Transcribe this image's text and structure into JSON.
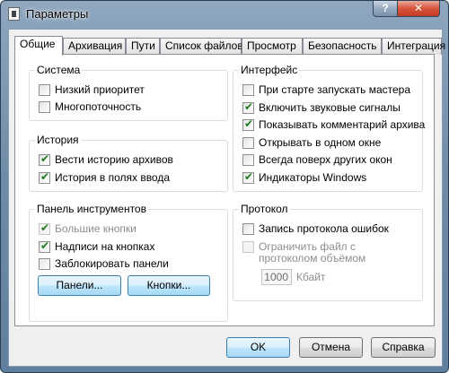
{
  "window": {
    "title": "Параметры",
    "help": "?",
    "close": "✕"
  },
  "tabs": [
    "Общие",
    "Архивация",
    "Пути",
    "Список файлов",
    "Просмотр",
    "Безопасность",
    "Интеграция"
  ],
  "groups": {
    "system": {
      "title": "Система",
      "items": [
        {
          "label": "Низкий приоритет",
          "checked": false,
          "disabled": false
        },
        {
          "label": "Многопоточность",
          "checked": false,
          "disabled": false
        }
      ]
    },
    "history": {
      "title": "История",
      "items": [
        {
          "label": "Вести историю архивов",
          "checked": true,
          "disabled": false
        },
        {
          "label": "История в полях ввода",
          "checked": true,
          "disabled": false
        }
      ]
    },
    "toolbar": {
      "title": "Панель инструментов",
      "items": [
        {
          "label": "Большие кнопки",
          "checked": true,
          "disabled": true
        },
        {
          "label": "Надписи на кнопках",
          "checked": true,
          "disabled": false
        },
        {
          "label": "Заблокировать панели",
          "checked": false,
          "disabled": false
        }
      ],
      "panels_button": "Панели...",
      "buttons_button": "Кнопки..."
    },
    "interface": {
      "title": "Интерфейс",
      "items": [
        {
          "label": "При старте запускать мастера",
          "checked": false,
          "disabled": false
        },
        {
          "label": "Включить звуковые сигналы",
          "checked": true,
          "disabled": false
        },
        {
          "label": "Показывать комментарий архива",
          "checked": true,
          "disabled": false
        },
        {
          "label": "Открывать в одном окне",
          "checked": false,
          "disabled": false
        },
        {
          "label": "Всегда поверх других окон",
          "checked": false,
          "disabled": false
        },
        {
          "label": "Индикаторы Windows",
          "checked": true,
          "disabled": false
        }
      ]
    },
    "protocol": {
      "title": "Протокол",
      "items": [
        {
          "label": "Запись протокола ошибок",
          "checked": false,
          "disabled": false
        },
        {
          "label": "Ограничить файл с",
          "checked": false,
          "disabled": true
        }
      ],
      "limit_line2": "протоколом объёмом",
      "size_value": "1000",
      "size_unit": "Кбайт"
    }
  },
  "footer": {
    "ok": "OK",
    "cancel": "Отмена",
    "help": "Справка"
  }
}
